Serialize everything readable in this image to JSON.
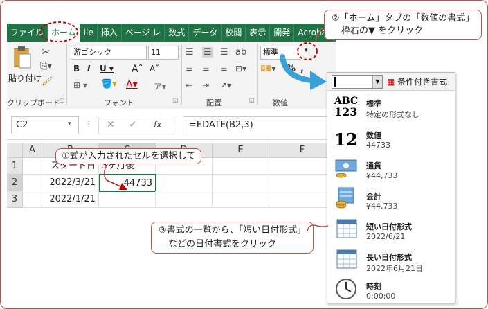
{
  "tabs": [
    "ファイル",
    "ホーム",
    "ile",
    "挿入",
    "ページ レ",
    "数式",
    "データ",
    "校閲",
    "表示",
    "開発",
    "Acrobat"
  ],
  "ribbon": {
    "paste_label": "貼り付け",
    "font_name": "游ゴシック",
    "font_size": "11",
    "number_format": "標準",
    "groups": {
      "clipboard": "クリップボード",
      "font": "フォント",
      "alignment": "配置",
      "number": "数値"
    }
  },
  "formula_bar": {
    "name_box": "C2",
    "fx": "fx",
    "formula": "=EDATE(B2,3)"
  },
  "grid": {
    "columns": [
      "A",
      "B",
      "C",
      "D",
      "E",
      "F"
    ],
    "rows": [
      {
        "num": "1",
        "b": "スタート日",
        "c": "3ヶ月後"
      },
      {
        "num": "2",
        "b": "2022/3/21",
        "c": "44733"
      },
      {
        "num": "3",
        "b": "2022/1/21",
        "c": ""
      }
    ]
  },
  "dropdown": {
    "conditional_format": "条件付き書式",
    "items": [
      {
        "name": "標準",
        "example": "特定の形式なし",
        "icon": "abc-123-icon"
      },
      {
        "name": "数値",
        "example": "44733",
        "icon": "number-12-icon"
      },
      {
        "name": "通貨",
        "example": "¥44,733",
        "icon": "currency-icon"
      },
      {
        "name": "会計",
        "example": " ¥44,733",
        "icon": "accounting-icon"
      },
      {
        "name": "短い日付形式",
        "example": "2022/6/21",
        "icon": "calendar-icon"
      },
      {
        "name": "長い日付形式",
        "example": "2022年6月21日",
        "icon": "calendar-icon"
      },
      {
        "name": "時刻",
        "example": "0:00:00",
        "icon": "clock-icon"
      }
    ]
  },
  "callouts": {
    "step1": "①式が入力されたセルを選択して",
    "step2_line1": "②「ホーム」タブの「数値の書式」",
    "step2_line2": "枠右の▼ をクリック",
    "step3_line1": "③書式の一覧から、「短い日付形式」",
    "step3_line2": "などの日付書式をクリック"
  },
  "colors": {
    "excel_green": "#217346",
    "callout_red": "#c0504d",
    "arrow_blue": "#3aa0d8"
  }
}
